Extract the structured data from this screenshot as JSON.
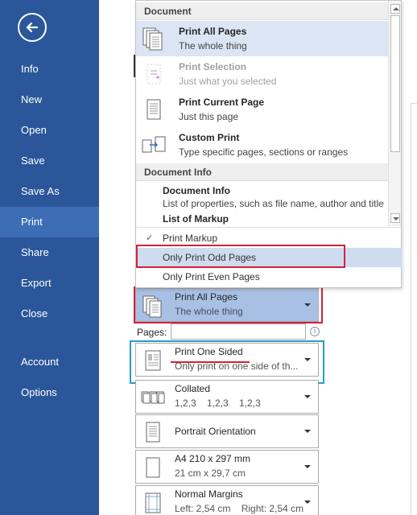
{
  "sidebar": {
    "back_icon": "back-arrow-icon",
    "items": [
      {
        "label": "Info"
      },
      {
        "label": "New"
      },
      {
        "label": "Open"
      },
      {
        "label": "Save"
      },
      {
        "label": "Save As"
      },
      {
        "label": "Print",
        "selected": true
      },
      {
        "label": "Share"
      },
      {
        "label": "Export"
      },
      {
        "label": "Close"
      },
      {
        "label": "Account"
      },
      {
        "label": "Options"
      }
    ]
  },
  "dropdown": {
    "section_document": "Document",
    "items": [
      {
        "title": "Print All Pages",
        "subtitle": "The whole thing",
        "icon": "pages-icon",
        "active": true
      },
      {
        "title": "Print Selection",
        "subtitle": "Just what you selected",
        "icon": "selection-icon",
        "disabled": true
      },
      {
        "title": "Print Current Page",
        "subtitle": "Just this page",
        "icon": "page-icon"
      },
      {
        "title": "Custom Print",
        "subtitle": "Type specific pages, sections or ranges",
        "icon": "custom-print-icon"
      }
    ],
    "section_info": "Document Info",
    "info_items": [
      {
        "title": "Document Info",
        "subtitle": "List of properties, such as file name, author and title"
      },
      {
        "title": "List of Markup"
      }
    ],
    "options": [
      {
        "label": "Print Markup",
        "checked": true
      },
      {
        "label": "Only Print Odd Pages",
        "highlighted": true
      },
      {
        "label": "Only Print Even Pages"
      }
    ]
  },
  "settings": {
    "print_range": {
      "title": "Print All Pages",
      "subtitle": "The whole thing"
    },
    "pages_label": "Pages:",
    "pages_value": "",
    "sides": {
      "title": "Print One Sided",
      "subtitle": "Only print on one side of th..."
    },
    "collation": {
      "title": "Collated",
      "subtitle": "1,2,3    1,2,3    1,2,3"
    },
    "orientation": {
      "title": "Portrait Orientation"
    },
    "paper": {
      "title": "A4 210 x 297 mm",
      "subtitle": "21 cm x 29,7 cm"
    },
    "margins": {
      "title": "Normal Margins",
      "subtitle": "Left: 2,54 cm    Right: 2,54 cm"
    }
  },
  "colors": {
    "sidebar": "#2b579a",
    "selected_nav": "#3d6db5",
    "highlight_red": "#d0223a",
    "highlight_blue": "#2a9bc4"
  }
}
